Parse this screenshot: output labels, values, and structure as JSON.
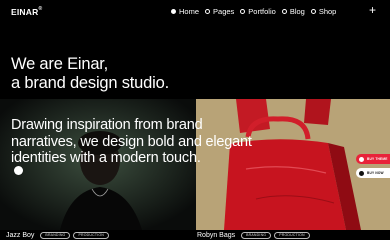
{
  "header": {
    "logo": "EINAR",
    "logo_mark": "®",
    "nav": [
      {
        "label": "Home",
        "active": true
      },
      {
        "label": "Pages",
        "active": false
      },
      {
        "label": "Portfolio",
        "active": false
      },
      {
        "label": "Blog",
        "active": false
      },
      {
        "label": "Shop",
        "active": false
      }
    ],
    "menu_icon": "plus-icon"
  },
  "hero": {
    "line1": "We are Einar,",
    "line2": "a brand design studio."
  },
  "overlay": {
    "line1": "Drawing inspiration from brand",
    "line2": "narratives, we design bold and elegant",
    "line3": "identities with a modern touch."
  },
  "side_buttons": {
    "primary": "BUY THEME",
    "secondary": "BUY NOW"
  },
  "projects": [
    {
      "title": "Jazz Boy",
      "tags": [
        "BRANDING",
        "PRODUCTION"
      ]
    },
    {
      "title": "Robyn Bags",
      "tags": [
        "BRANDING",
        "PRODUCTION"
      ]
    }
  ],
  "colors": {
    "background": "#000000",
    "text": "#ffffff",
    "accent": "#e8233a",
    "bag_red": "#c7141f"
  }
}
